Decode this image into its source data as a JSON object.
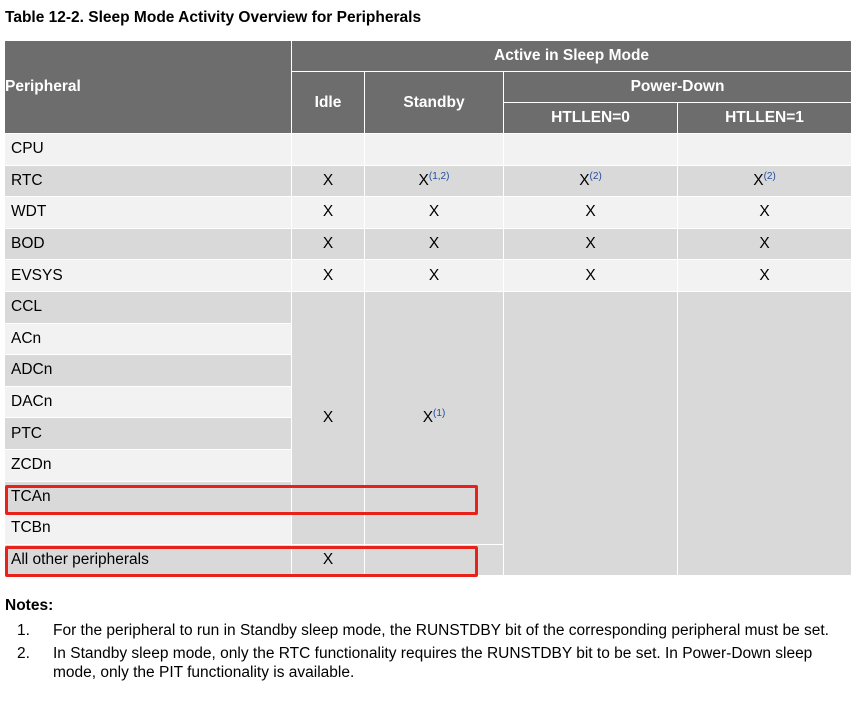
{
  "title": "Table 12-2.  Sleep Mode Activity Overview for Peripherals",
  "header": {
    "peripheral": "Peripheral",
    "active": "Active in Sleep Mode",
    "idle": "Idle",
    "standby": "Standby",
    "power_down": "Power-Down",
    "htllen0": "HTLLEN=0",
    "htllen1": "HTLLEN=1"
  },
  "rows": [
    {
      "name": "CPU",
      "idle": "",
      "standby": "",
      "standby_ref": "",
      "pd0": "",
      "pd0_ref": "",
      "pd1": "",
      "pd1_ref": ""
    },
    {
      "name": "RTC",
      "idle": "X",
      "standby": "X",
      "standby_ref": "(1,2)",
      "pd0": "X",
      "pd0_ref": "(2)",
      "pd1": "X",
      "pd1_ref": "(2)"
    },
    {
      "name": "WDT",
      "idle": "X",
      "standby": "X",
      "standby_ref": "",
      "pd0": "X",
      "pd0_ref": "",
      "pd1": "X",
      "pd1_ref": ""
    },
    {
      "name": "BOD",
      "idle": "X",
      "standby": "X",
      "standby_ref": "",
      "pd0": "X",
      "pd0_ref": "",
      "pd1": "X",
      "pd1_ref": ""
    },
    {
      "name": "EVSYS",
      "idle": "X",
      "standby": "X",
      "standby_ref": "",
      "pd0": "X",
      "pd0_ref": "",
      "pd1": "X",
      "pd1_ref": ""
    }
  ],
  "group_rows": [
    "CCL",
    "ACn",
    "ADCn",
    "DACn",
    "PTC",
    "ZCDn",
    "TCAn",
    "TCBn"
  ],
  "group_values": {
    "idle": "X",
    "standby": "X",
    "standby_ref": "(1)"
  },
  "last_row": {
    "name": "All other peripherals",
    "idle": "X"
  },
  "notes": {
    "heading": "Notes:",
    "items": [
      {
        "num": "1.",
        "text": "For the peripheral to run in Standby sleep mode, the RUNSTDBY bit of the corresponding peripheral must be set."
      },
      {
        "num": "2.",
        "text": "In Standby sleep mode, only the RTC functionality requires the RUNSTDBY bit to be set. In Power-Down sleep mode, only the PIT functionality is available."
      }
    ]
  },
  "highlight_color": "#e8211a"
}
